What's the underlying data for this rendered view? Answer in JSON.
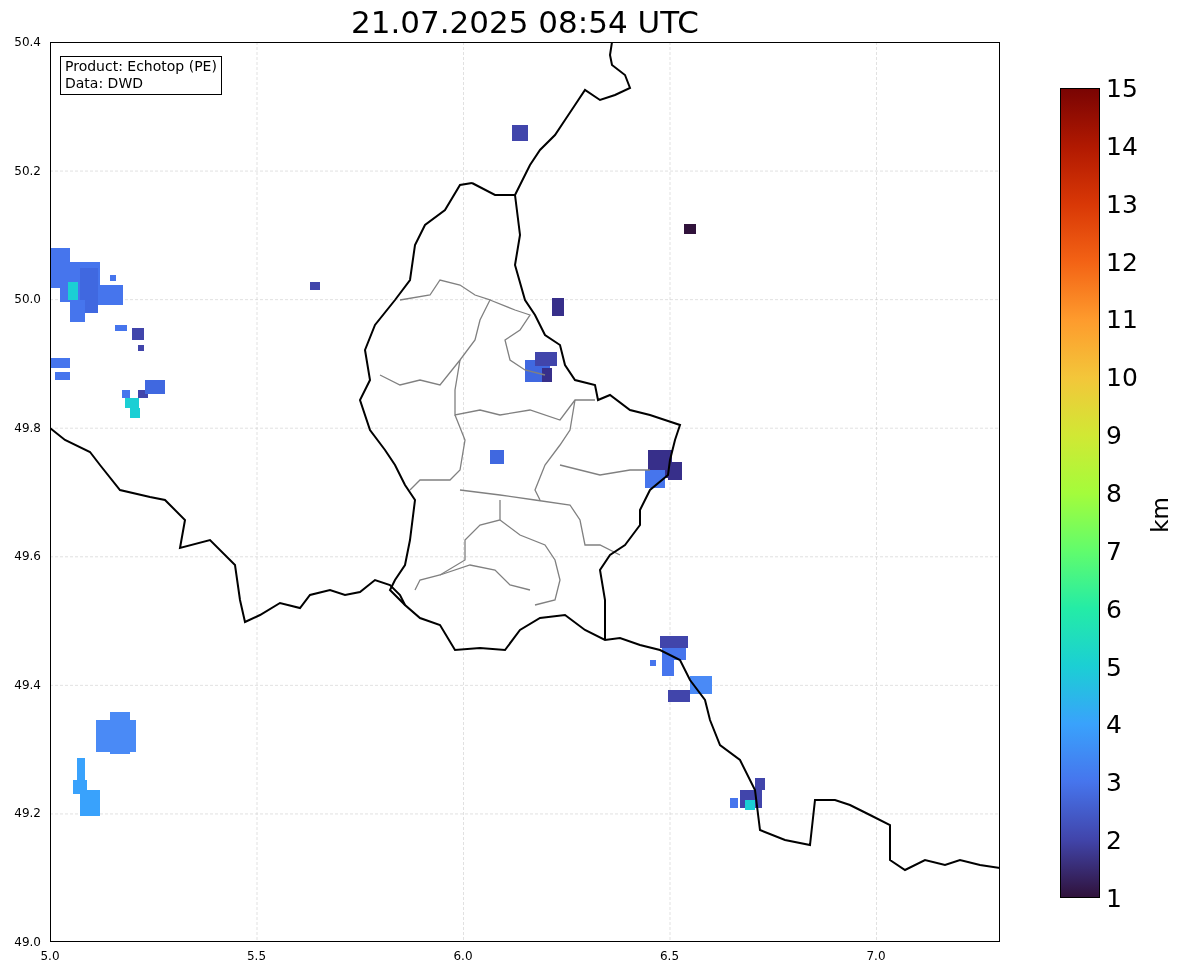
{
  "title": "21.07.2025 08:54 UTC",
  "info_box": [
    "Product: Echotop (PE)",
    "Data: DWD"
  ],
  "y_ticks": [
    "50.4",
    "50.2",
    "50.0",
    "49.8",
    "49.6",
    "49.4",
    "49.2",
    "49.0"
  ],
  "x_ticks": [
    "5.0",
    "5.5",
    "6.0",
    "6.5",
    "7.0"
  ],
  "colorbar": {
    "label": "km",
    "ticks": [
      "15",
      "14",
      "13",
      "12",
      "11",
      "10",
      "9",
      "8",
      "7",
      "6",
      "5",
      "4",
      "3",
      "2",
      "1"
    ]
  }
}
